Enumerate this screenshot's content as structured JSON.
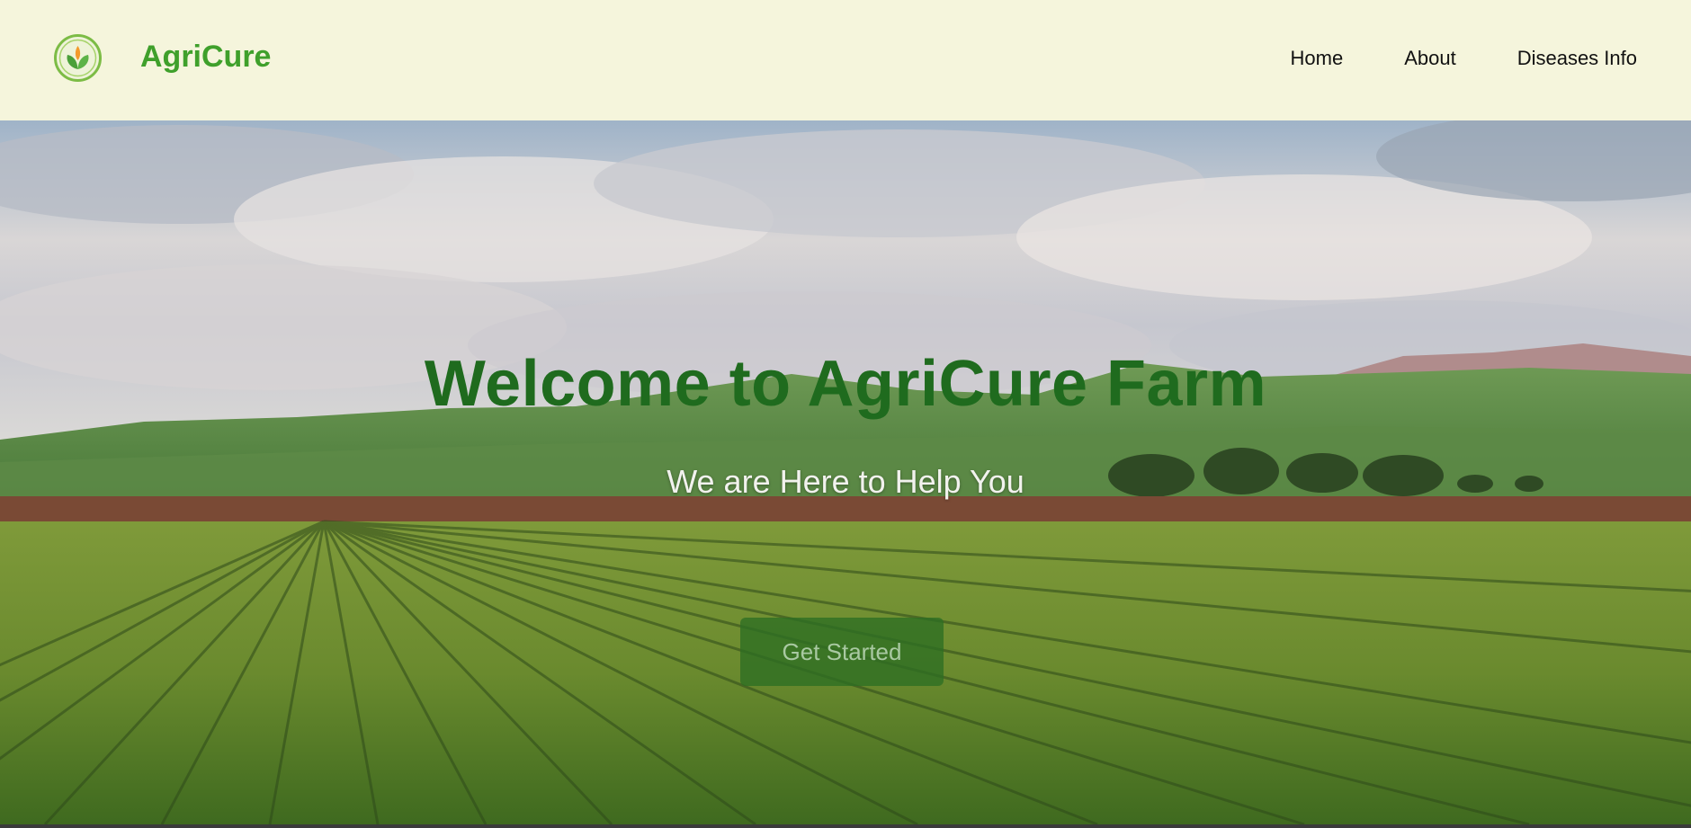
{
  "header": {
    "brand": "AgriCure",
    "logo_icon": "leaf-icon",
    "nav": [
      {
        "label": "Home"
      },
      {
        "label": "About"
      },
      {
        "label": "Diseases Info"
      }
    ]
  },
  "hero": {
    "title": "Welcome to AgriCure Farm",
    "subtitle": "We are Here to Help You",
    "cta_label": "Get Started",
    "background": "farm-field-image"
  },
  "colors": {
    "header_bg": "#f5f5dc",
    "brand": "#3fa02b",
    "title": "#1f6b1e",
    "cta_bg": "#2d6e23"
  }
}
